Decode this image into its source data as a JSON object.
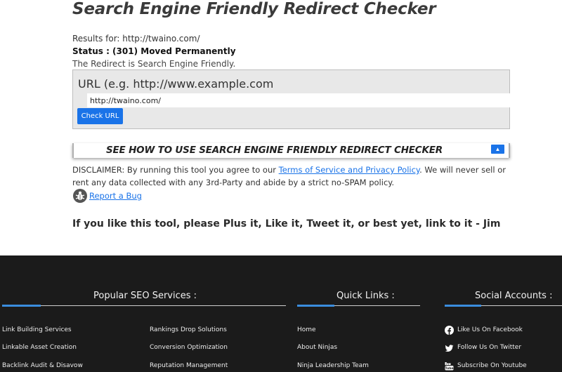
{
  "page": {
    "title": "Search Engine Friendly Redirect Checker",
    "results_for": "Results for: http://twaino.com/",
    "status": "Status : (301) Moved Permanently",
    "friendly_msg": "The Redirect is Search Engine Friendly."
  },
  "form": {
    "label": "URL (e.g. http://www.example.com",
    "url_value": "http://twaino.com/",
    "button_label": "Check URL"
  },
  "howto": {
    "label": "SEE HOW TO USE SEARCH ENGINE FRIENDLY REDIRECT CHECKER",
    "toggle_icon": "chevron-up-icon"
  },
  "disclaimer": {
    "before_link": "DISCLAIMER: By running this tool you agree to our ",
    "link_text": "Terms of Service and Privacy Policy",
    "after_link": ". We will never sell or rent any data collected with any 3rd-Party and abide by a strict no-SPAM policy."
  },
  "report": {
    "label": "Report a Bug",
    "icon": "bug-icon"
  },
  "like_message": "If you like this tool, please Plus it, Like it, Tweet it, or best yet, link to it - Jim",
  "footer": {
    "popular": {
      "heading": "Popular SEO Services :",
      "col1": [
        "Link Building Services",
        "Linkable Asset Creation",
        "Backlink Audit & Disavow"
      ],
      "col2": [
        "Rankings Drop Solutions",
        "Conversion Optimization",
        "Reputation Management"
      ]
    },
    "quick": {
      "heading": "Quick Links :",
      "items": [
        "Home",
        "About Ninjas",
        "Ninja Leadership Team"
      ]
    },
    "social": {
      "heading": "Social Accounts :",
      "items": [
        {
          "label": "Like Us On Facebook",
          "icon": "facebook-icon"
        },
        {
          "label": "Follow Us On Twitter",
          "icon": "twitter-icon"
        },
        {
          "label": "Subscribe On Youtube",
          "icon": "youtube-icon"
        }
      ]
    }
  },
  "colors": {
    "accent_blue": "#1a73e8",
    "footer_bg": "#1b1b1b",
    "underline_accent": "#3a8dde"
  }
}
